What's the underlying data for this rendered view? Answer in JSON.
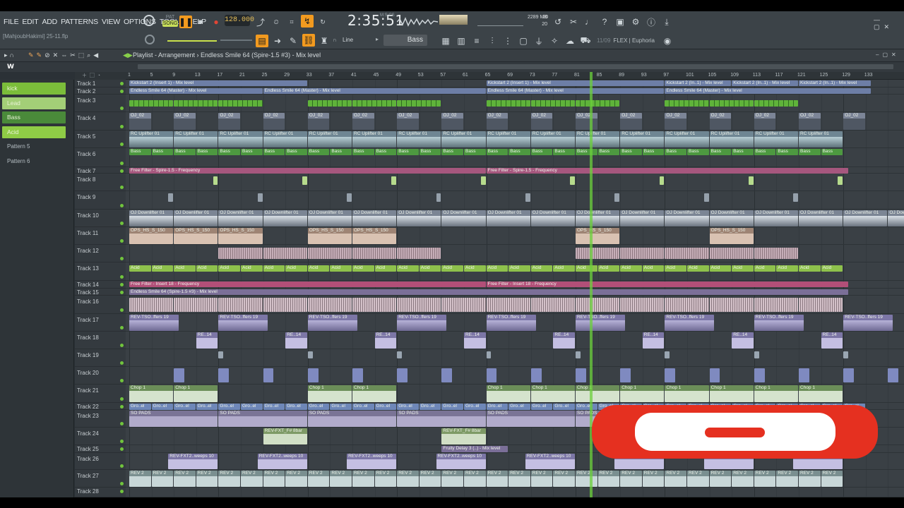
{
  "menu": [
    "FILE",
    "EDIT",
    "ADD",
    "PATTERNS",
    "VIEW",
    "OPTIONS",
    "TOOLS",
    "HELP"
  ],
  "project_file": "[MahjoubHakimi] 25-11.flp",
  "transport": {
    "mode_top": "PAT",
    "mode_bottom": "SONG",
    "tempo": "128.000",
    "time": "2:35:51",
    "time_unit": "M:S:CS",
    "cpu": "20",
    "memory": "2289 MB",
    "voices": "20"
  },
  "snap_mode": "Line",
  "pattern_selector": "Bass",
  "hint_bar": {
    "date": "11/09",
    "text": "FLEX | Euphoria"
  },
  "playlist": {
    "title": "Playlist - Arrangement",
    "breadcrumb": "Endless Smile 64 (Spire-1.5 #3) - Mix level"
  },
  "ruler": [
    "1",
    "5",
    "9",
    "13",
    "17",
    "21",
    "25",
    "29",
    "33",
    "37",
    "41",
    "45",
    "49",
    "53",
    "57",
    "61",
    "65",
    "69",
    "73",
    "77",
    "81",
    "85",
    "89",
    "93",
    "97",
    "101",
    "105",
    "109",
    "113",
    "117",
    "121",
    "125",
    "129",
    "133"
  ],
  "patterns": [
    {
      "name": "kick",
      "color": "#7bbd3a"
    },
    {
      "name": "Lead",
      "color": "#a3cf77"
    },
    {
      "name": "Bass",
      "color": "#4a8a3a"
    },
    {
      "name": "Acid",
      "color": "#8fcc46"
    },
    {
      "name": "Pattern 5",
      "color": ""
    },
    {
      "name": "Pattern 6",
      "color": ""
    }
  ],
  "tracks": [
    "Track 1",
    "Track 2",
    "Track 3",
    "Track 4",
    "Track 5",
    "Track 6",
    "Track 7",
    "Track 8",
    "Track 9",
    "Track 10",
    "Track 11",
    "Track 12",
    "Track 13",
    "Track 14",
    "Track 15",
    "Track 16",
    "Track 17",
    "Track 18",
    "Track 19",
    "Track 20",
    "Track 21",
    "Track 22",
    "Track 23",
    "Track 24",
    "Track 25",
    "Track 26",
    "Track 27",
    "Track 28"
  ],
  "clip_labels": {
    "t1": "Kickstart 2 (Insert 1) - Mix level",
    "t1b": "Kickstart 2 (In..1) - Mix level",
    "t2": "Endless Smile 64 (Master) - Mix level",
    "t4": "OJ_02",
    "t5": "RC Uplifter 01",
    "t6": "Bass",
    "t7": "Free Filter - Spire-1.5 - Frequency",
    "t10": "OJ Downlifter 01",
    "t11": "OPS_HS_S_150",
    "t13": "Acid",
    "t14": "Free Filter - Insert 18 - Frequency",
    "t15": "Endless Smile 64 (Spire-1.5 #3) - Mix level",
    "t17": "REV-TSO..ffers 19",
    "t18": "RE..14",
    "t21": "Chop 1",
    "t22": "Gro..el",
    "t23": "SO PADS",
    "t24": "REV-FXT_F# 8bar",
    "t25": "Fruity Delay 3 (..) - Mix level",
    "t26": "REV-FXT2..weeps 10",
    "t27": "REV 2"
  }
}
